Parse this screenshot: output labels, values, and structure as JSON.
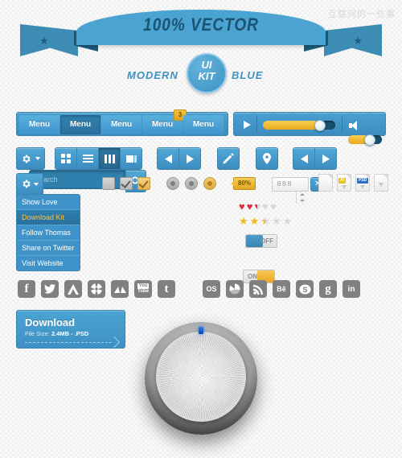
{
  "watermark": "互联网的一些事",
  "ribbon": {
    "text": "100% VECTOR",
    "star_glyph": "★"
  },
  "badge": {
    "left_label": "MODERN",
    "right_label": "BLUE",
    "line1": "UI",
    "line2": "KIT"
  },
  "menu": {
    "items": [
      {
        "label": "Menu",
        "state": "normal",
        "badge": ""
      },
      {
        "label": "Menu",
        "state": "active",
        "badge": ""
      },
      {
        "label": "Menu",
        "state": "normal",
        "badge": ""
      },
      {
        "label": "Menu",
        "state": "normal",
        "badge": "3"
      },
      {
        "label": "Menu",
        "state": "normal",
        "badge": ""
      }
    ]
  },
  "player": {
    "play_icon": "play-icon",
    "progress_percent": 78,
    "volume_percent": 62,
    "volume_icon": "speaker-icon"
  },
  "toolbar": {
    "gear_icon": "gear-icon",
    "view_modes": [
      {
        "icon": "grid-view-icon",
        "active": false
      },
      {
        "icon": "list-view-icon",
        "active": false
      },
      {
        "icon": "column-view-icon",
        "active": true
      },
      {
        "icon": "gallery-view-icon",
        "active": false
      }
    ],
    "prev_icon": "arrow-left-icon",
    "next_icon": "arrow-right-icon",
    "pencil_icon": "pencil-icon",
    "pin_icon": "map-pin-icon",
    "prev_icon_2": "arrow-left-icon",
    "next_icon_2": "arrow-right-icon"
  },
  "search": {
    "placeholder": "Search",
    "value": "",
    "button_icon": "search-icon"
  },
  "dropdown": {
    "trigger_icon": "gear-icon",
    "items": [
      {
        "label": "Show Love",
        "selected": false
      },
      {
        "label": "Download Kit",
        "selected": true
      },
      {
        "label": "Follow Thomas",
        "selected": false
      },
      {
        "label": "Share on Twitter",
        "selected": false
      },
      {
        "label": "Visit Website",
        "selected": false
      }
    ]
  },
  "controls": {
    "checkboxes": [
      {
        "checked": false,
        "color": "gray"
      },
      {
        "checked": true,
        "color": "gray"
      },
      {
        "checked": true,
        "color": "orange"
      }
    ],
    "radios": [
      {
        "selected": true,
        "color": "gray"
      },
      {
        "selected": true,
        "color": "gray"
      },
      {
        "selected": true,
        "color": "orange"
      }
    ],
    "tag_label": "80%",
    "small_buttons": [
      {
        "label": "−",
        "name": "minus-button"
      },
      {
        "label": "+",
        "name": "plus-button"
      },
      {
        "label": "✕",
        "name": "close-button"
      }
    ]
  },
  "stepper": {
    "value": "888",
    "up_icon": "caret-up-icon",
    "down_icon": "caret-down-icon"
  },
  "files": [
    {
      "label": "",
      "badge_color": ""
    },
    {
      "label": "AI",
      "badge_color": "#e8c020"
    },
    {
      "label": "PSD",
      "badge_color": "#2a6fc4"
    },
    {
      "label": "",
      "badge_color": ""
    }
  ],
  "ratings": {
    "hearts": {
      "value": 2.5,
      "max": 5,
      "glyph": "♥",
      "filled_color": "#e02b3c",
      "empty_color": "#d8d8d8"
    },
    "stars": {
      "value": 2.5,
      "max": 5,
      "glyph": "★",
      "filled_color": "#f2b821",
      "empty_color": "#d8d8d8"
    }
  },
  "toggles": [
    {
      "label": "OFF",
      "state": "off",
      "knob_color": "#4c9dc9"
    },
    {
      "label": "ON",
      "state": "on",
      "knob_color": "#f0b431"
    }
  ],
  "social_row_1": [
    {
      "name": "facebook-icon",
      "glyph": "f"
    },
    {
      "name": "twitter-icon",
      "glyph": "ᵗ"
    },
    {
      "name": "appnet-icon",
      "glyph": "A"
    },
    {
      "name": "dribbble-icon",
      "glyph": "✸"
    },
    {
      "name": "deviantart-icon",
      "glyph": "◢◣"
    },
    {
      "name": "youtube-icon",
      "glyph": "You"
    },
    {
      "name": "tumblr-icon",
      "glyph": "t"
    }
  ],
  "social_row_2": [
    {
      "name": "lastfm-icon",
      "glyph": "OS"
    },
    {
      "name": "picasa-icon",
      "glyph": "◔"
    },
    {
      "name": "rss-icon",
      "glyph": "ᴴ"
    },
    {
      "name": "behance-icon",
      "glyph": "Bē"
    },
    {
      "name": "skype-icon",
      "glyph": "S"
    },
    {
      "name": "google-icon",
      "glyph": "g"
    },
    {
      "name": "linkedin-icon",
      "glyph": "in"
    }
  ],
  "download": {
    "title": "Download",
    "subtitle_prefix": "File Size: ",
    "subtitle_value": "2.4MB - .PSD"
  },
  "knob": {
    "name": "volume-knob",
    "indicator": "led-indicator",
    "led_color": "#1d5fe0"
  },
  "colors": {
    "accent_blue": "#4a9fd0",
    "dark_blue": "#1c5a78",
    "orange": "#e8a91d",
    "heart_red": "#e02b3c",
    "star_gold": "#f2b821"
  }
}
